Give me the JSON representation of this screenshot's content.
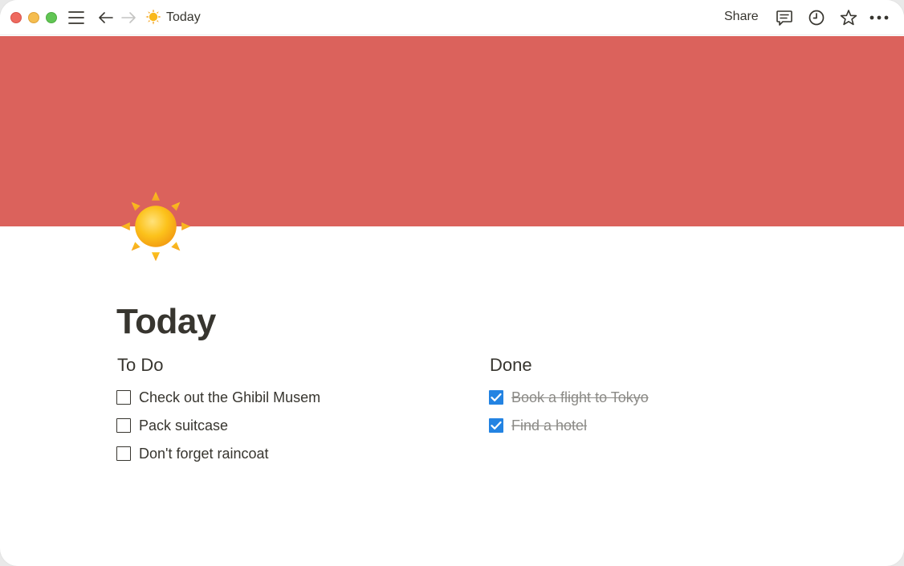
{
  "window": {
    "traffic_lights": [
      "close",
      "minimize",
      "maximize"
    ]
  },
  "toolbar": {
    "page_emoji": "sun-icon",
    "breadcrumb_title": "Today",
    "share_label": "Share",
    "icons": [
      "sidebar-menu-icon",
      "back-arrow-icon",
      "forward-arrow-icon",
      "comment-icon",
      "history-icon",
      "star-icon",
      "more-icon"
    ]
  },
  "cover": {
    "color": "#db625c"
  },
  "page": {
    "icon": "sun-icon",
    "title": "Today"
  },
  "columns": {
    "todo": {
      "heading": "To Do",
      "items": [
        {
          "text": "Check out the Ghibil Musem",
          "checked": false
        },
        {
          "text": "Pack suitcase",
          "checked": false
        },
        {
          "text": "Don't forget raincoat",
          "checked": false
        }
      ]
    },
    "done": {
      "heading": "Done",
      "items": [
        {
          "text": "Book a flight to Tokyo",
          "checked": true
        },
        {
          "text": "Find a hotel",
          "checked": true
        }
      ]
    }
  },
  "colors": {
    "accent_checkbox": "#2383e2",
    "text": "#37352f",
    "done_text": "#8b8a86"
  }
}
